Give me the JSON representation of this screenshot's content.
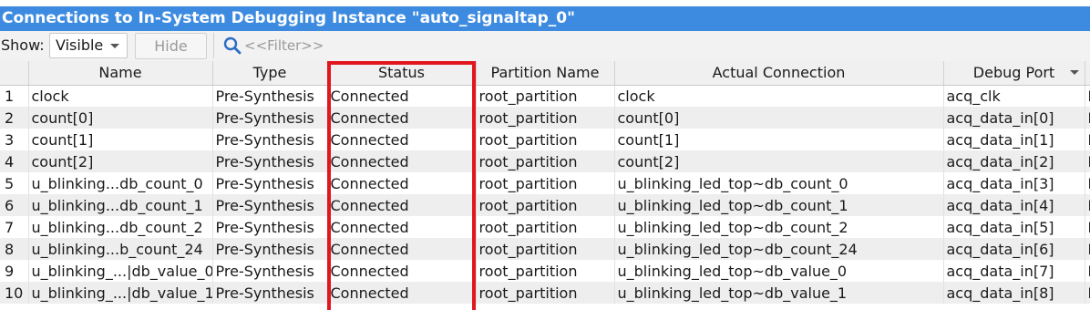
{
  "window": {
    "title": "Connections to In-System Debugging Instance \"auto_signaltap_0\""
  },
  "toolbar": {
    "show_label": "Show:",
    "show_value": "Visible",
    "hide_label": "Hide",
    "filter_placeholder": "<<Filter>>"
  },
  "table": {
    "columns": [
      "",
      "Name",
      "Type",
      "Status",
      "Partition Name",
      "Actual Connection",
      "Debug Port",
      ""
    ],
    "rows": [
      [
        "1",
        "clock",
        "Pre-Synthesis",
        "Connected",
        "root_partition",
        "clock",
        "acq_clk",
        "N"
      ],
      [
        "2",
        "count[0]",
        "Pre-Synthesis",
        "Connected",
        "root_partition",
        "count[0]",
        "acq_data_in[0]",
        "N"
      ],
      [
        "3",
        "count[1]",
        "Pre-Synthesis",
        "Connected",
        "root_partition",
        "count[1]",
        "acq_data_in[1]",
        "N"
      ],
      [
        "4",
        "count[2]",
        "Pre-Synthesis",
        "Connected",
        "root_partition",
        "count[2]",
        "acq_data_in[2]",
        "N"
      ],
      [
        "5",
        "u_blinking...db_count_0",
        "Pre-Synthesis",
        "Connected",
        "root_partition",
        "u_blinking_led_top~db_count_0",
        "acq_data_in[3]",
        "N"
      ],
      [
        "6",
        "u_blinking...db_count_1",
        "Pre-Synthesis",
        "Connected",
        "root_partition",
        "u_blinking_led_top~db_count_1",
        "acq_data_in[4]",
        "N"
      ],
      [
        "7",
        "u_blinking...db_count_2",
        "Pre-Synthesis",
        "Connected",
        "root_partition",
        "u_blinking_led_top~db_count_2",
        "acq_data_in[5]",
        "N"
      ],
      [
        "8",
        "u_blinking...b_count_24",
        "Pre-Synthesis",
        "Connected",
        "root_partition",
        "u_blinking_led_top~db_count_24",
        "acq_data_in[6]",
        "N"
      ],
      [
        "9",
        "u_blinking_...|db_value_0",
        "Pre-Synthesis",
        "Connected",
        "root_partition",
        "u_blinking_led_top~db_value_0",
        "acq_data_in[7]",
        "N"
      ],
      [
        "10",
        "u_blinking_...|db_value_1",
        "Pre-Synthesis",
        "Connected",
        "root_partition",
        "u_blinking_led_top~db_value_1",
        "acq_data_in[8]",
        "N"
      ]
    ]
  },
  "colors": {
    "title_bg": "#3d8be0",
    "highlight": "#e2161e",
    "row_alt": "#eeeeee"
  },
  "icons": {
    "filter": "search-icon",
    "dropdown": "chevron-down-icon",
    "sort": "sort-arrow-icon"
  }
}
